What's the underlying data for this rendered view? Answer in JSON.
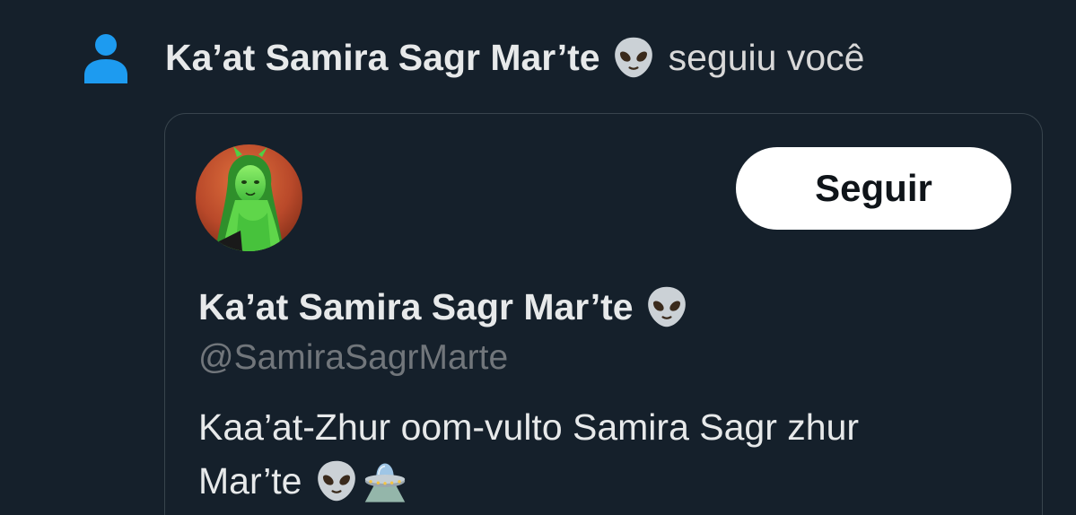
{
  "notification": {
    "icon": "person-icon",
    "name": "Ka’at Samira Sagr Mar’te",
    "name_emoji": "alien-emoji",
    "action": "seguiu você"
  },
  "profile_card": {
    "avatar": "profile-avatar",
    "follow_label": "Seguir",
    "display_name": "Ka’at Samira Sagr Mar’te",
    "display_name_emoji": "alien-emoji",
    "handle": "@SamiraSagrMarte",
    "bio_line1": "Kaa’at-Zhur oom-vulto Samira Sagr zhur",
    "bio_line2": "Mar’te",
    "bio_emojis": [
      "alien-emoji",
      "flying-saucer-emoji"
    ]
  },
  "colors": {
    "background": "#15202b",
    "primary_text": "#e7e9ea",
    "secondary_text": "#71767b",
    "accent": "#1d9bf0",
    "card_border": "#38444d",
    "button_bg": "#ffffff"
  }
}
